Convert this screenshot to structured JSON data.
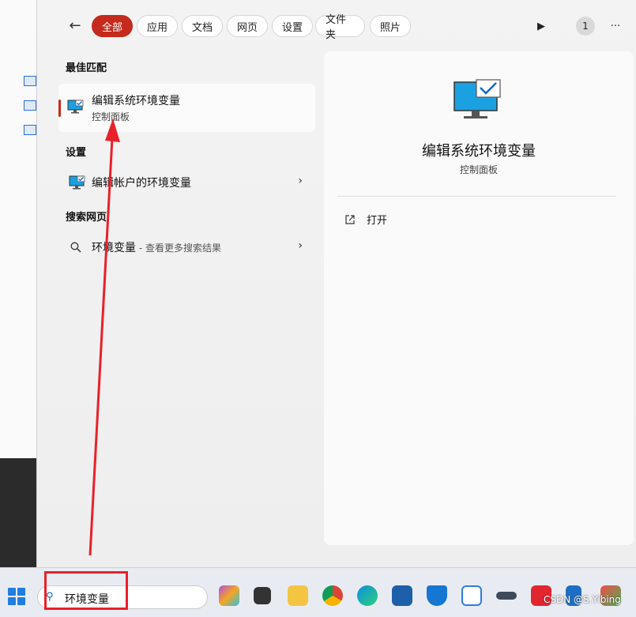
{
  "filters": [
    "全部",
    "应用",
    "文档",
    "网页",
    "设置",
    "文件夹",
    "照片"
  ],
  "toolbar": {
    "page_badge": "1",
    "more": "···",
    "play": "▶"
  },
  "sections": {
    "best_match": "最佳匹配",
    "settings": "设置",
    "web": "搜索网页"
  },
  "best_match": {
    "title": "编辑系统环境变量",
    "subtitle": "控制面板"
  },
  "settings_item": {
    "label": "编辑帐户的环境变量"
  },
  "web_item": {
    "label": "环境变量",
    "hint": " - 查看更多搜索结果"
  },
  "detail": {
    "title": "编辑系统环境变量",
    "subtitle": "控制面板",
    "action_open": "打开"
  },
  "taskbar": {
    "search_text": "环境变量"
  },
  "watermark": "CSDN @S.Yibing",
  "colors": {
    "accent": "#c42b1c",
    "annotation": "#e8212a"
  }
}
